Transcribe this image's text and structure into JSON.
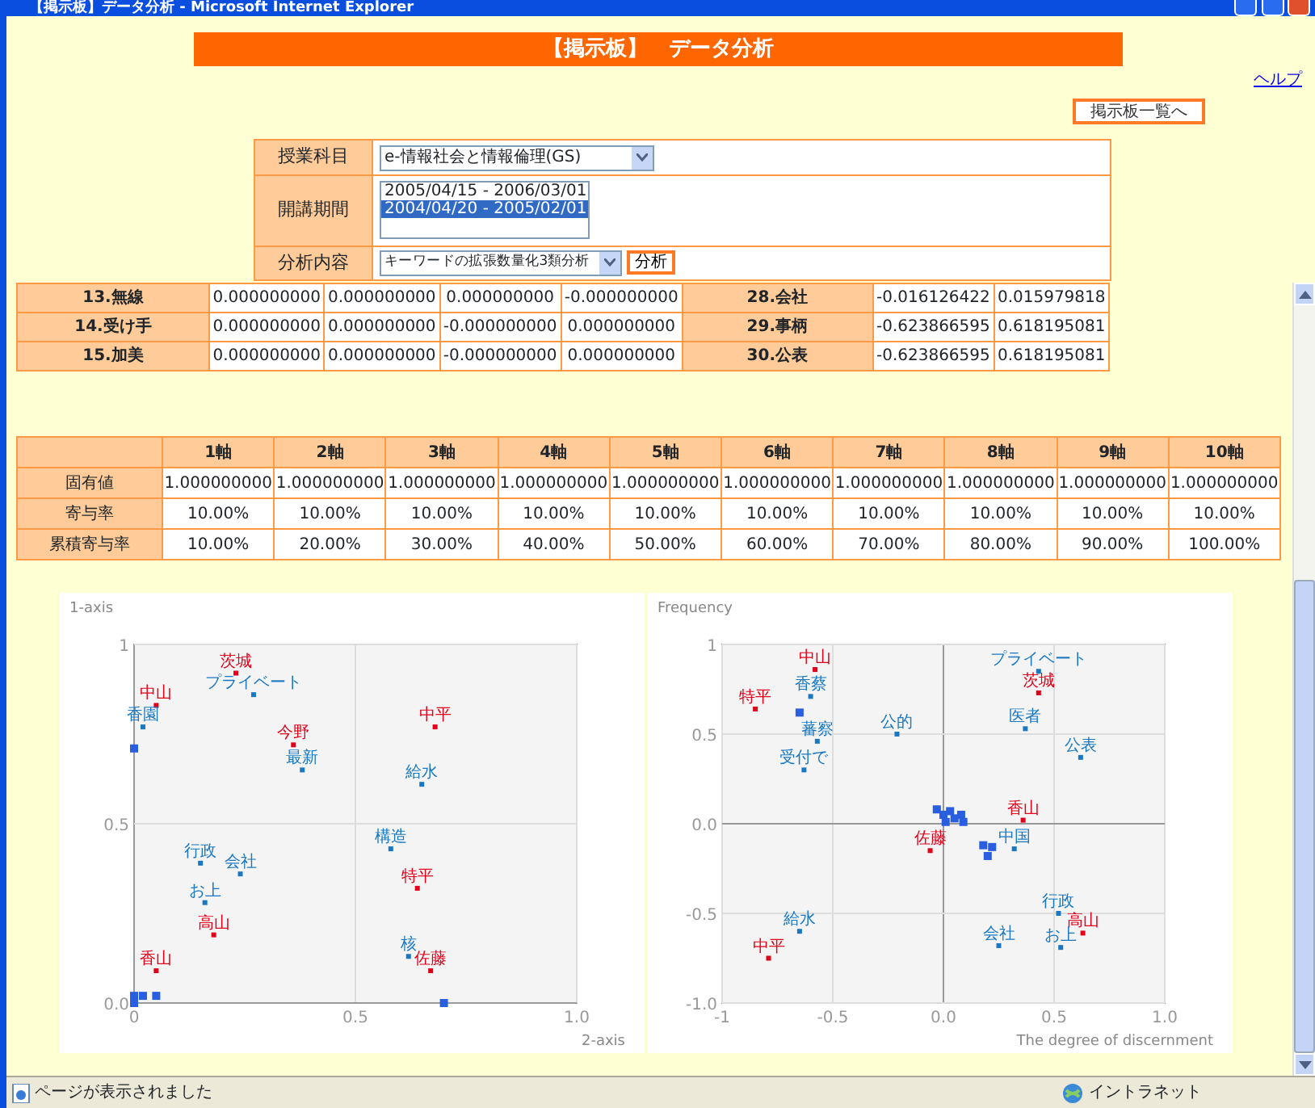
{
  "window": {
    "title": "【掲示板】データ分析 - Microsoft Internet Explorer"
  },
  "banner": {
    "title": "【掲示板】　データ分析"
  },
  "help_link": "ヘルプ",
  "board_list_button": "掲示板一覧へ",
  "form": {
    "rows": [
      {
        "label": "授業科目",
        "kind": "select",
        "value": "e-情報社会と情報倫理(GS)"
      },
      {
        "label": "開講期間",
        "kind": "listbox",
        "options": [
          {
            "text": "2005/04/15 - 2006/03/01",
            "selected": false
          },
          {
            "text": "2004/04/20 - 2005/02/01",
            "selected": true
          }
        ]
      },
      {
        "label": "分析内容",
        "kind": "select_button",
        "value": "キーワードの拡張数量化3類分析",
        "button": "分析"
      }
    ]
  },
  "score_table": {
    "rows": [
      {
        "term1": "13.無線",
        "values1": [
          "0.000000000",
          "0.000000000",
          "0.000000000",
          "-0.000000000"
        ],
        "term2": "28.会社",
        "values2": [
          "-0.016126422",
          "0.015979818"
        ]
      },
      {
        "term1": "14.受け手",
        "values1": [
          "0.000000000",
          "0.000000000",
          "-0.000000000",
          "0.000000000"
        ],
        "term2": "29.事柄",
        "values2": [
          "-0.623866595",
          "0.618195081"
        ]
      },
      {
        "term1": "15.加美",
        "values1": [
          "0.000000000",
          "0.000000000",
          "-0.000000000",
          "0.000000000"
        ],
        "term2": "30.公表",
        "values2": [
          "-0.623866595",
          "0.618195081"
        ]
      }
    ]
  },
  "axis_table": {
    "columns": [
      "1軸",
      "2軸",
      "3軸",
      "4軸",
      "5軸",
      "6軸",
      "7軸",
      "8軸",
      "9軸",
      "10軸"
    ],
    "rows": [
      {
        "label": "固有値",
        "values": [
          "1.000000000",
          "1.000000000",
          "1.000000000",
          "1.000000000",
          "1.000000000",
          "1.000000000",
          "1.000000000",
          "1.000000000",
          "1.000000000",
          "1.000000000"
        ]
      },
      {
        "label": "寄与率",
        "values": [
          "10.00%",
          "10.00%",
          "10.00%",
          "10.00%",
          "10.00%",
          "10.00%",
          "10.00%",
          "10.00%",
          "10.00%",
          "10.00%"
        ]
      },
      {
        "label": "累積寄与率",
        "values": [
          "10.00%",
          "20.00%",
          "30.00%",
          "40.00%",
          "50.00%",
          "60.00%",
          "70.00%",
          "80.00%",
          "90.00%",
          "100.00%"
        ]
      }
    ]
  },
  "charts": [
    {
      "chart_data": {
        "type": "scatter",
        "grid": true,
        "xlabel": "2-axis",
        "ylabel": "1-axis",
        "xlim": [
          0,
          1
        ],
        "ylim": [
          0,
          1
        ],
        "xticks": [
          {
            "value": 0,
            "label": "0"
          },
          {
            "value": 0.5,
            "label": "0.5"
          },
          {
            "value": 1,
            "label": "1.0"
          }
        ],
        "yticks": [
          {
            "value": 0,
            "label": "0.0"
          },
          {
            "value": 0.5,
            "label": "0.5"
          },
          {
            "value": 1,
            "label": "1"
          }
        ],
        "x": [
          0.23,
          0.27,
          0.05,
          0.02,
          0.36,
          0.38,
          0.68,
          0.65,
          0.58,
          0.15,
          0.24,
          0.64,
          0.16,
          0.18,
          0.62,
          0.05,
          0.67,
          0,
          0,
          0,
          0.02,
          0.05,
          0.7
        ],
        "series": [
          {
            "color": "#e0001a",
            "values": [
              0.92,
              null,
              0.83,
              null,
              0.72,
              null,
              0.77,
              null,
              null,
              null,
              null,
              0.32,
              null,
              0.19,
              null,
              0.09,
              0.09,
              null,
              null,
              null,
              null,
              null,
              null
            ]
          },
          {
            "color": "#1a78c2",
            "values": [
              null,
              0.86,
              null,
              0.77,
              null,
              0.65,
              null,
              0.61,
              0.43,
              0.39,
              0.36,
              null,
              0.28,
              null,
              0.13,
              null,
              null,
              null,
              null,
              null,
              null,
              null,
              null
            ]
          },
          {
            "color": "#2a5ee0",
            "values": [
              null,
              null,
              null,
              null,
              null,
              null,
              null,
              null,
              null,
              null,
              null,
              null,
              null,
              null,
              null,
              null,
              null,
              0.71,
              0.02,
              0,
              0.02,
              0.02,
              0
            ]
          }
        ],
        "annotations": [
          "茨城",
          "プライベート",
          "中山",
          "香園",
          "今野",
          "最新",
          "中平",
          "給水",
          "構造",
          "行政",
          "会社",
          "特平",
          "お上",
          "高山",
          "核",
          "香山",
          "佐藤"
        ]
      }
    },
    {
      "chart_data": {
        "type": "scatter",
        "grid": true,
        "xlabel": "The degree of discernment",
        "ylabel": "Frequency",
        "xlim": [
          -1,
          1
        ],
        "ylim": [
          -1,
          1
        ],
        "xticks": [
          {
            "value": -1,
            "label": "-1"
          },
          {
            "value": -0.5,
            "label": "-0.5"
          },
          {
            "value": 0,
            "label": "0.0"
          },
          {
            "value": 0.5,
            "label": "0.5"
          },
          {
            "value": 1,
            "label": "1.0"
          }
        ],
        "yticks": [
          {
            "value": -1,
            "label": "-1.0"
          },
          {
            "value": -0.5,
            "label": "-0.5"
          },
          {
            "value": 0,
            "label": "0.0"
          },
          {
            "value": 0.5,
            "label": "0.5"
          },
          {
            "value": 1,
            "label": "1"
          }
        ],
        "x": [
          0.43,
          -0.58,
          0.43,
          -0.85,
          -0.6,
          0.37,
          -0.21,
          -0.57,
          -0.63,
          0.62,
          -0.06,
          0.36,
          0.32,
          0.52,
          0.63,
          -0.65,
          0.25,
          0.53,
          -0.79,
          -0.65,
          -0.03,
          0,
          0.03,
          0.05,
          0.08,
          0.01,
          0.09,
          0.18,
          0.2,
          0.22
        ],
        "series": [
          {
            "color": "#e0001a",
            "values": [
              null,
              0.86,
              0.73,
              0.64,
              null,
              null,
              null,
              null,
              null,
              null,
              -0.15,
              0.02,
              null,
              null,
              -0.61,
              null,
              null,
              null,
              -0.75,
              null,
              null,
              null,
              null,
              null,
              null,
              null,
              null,
              null,
              null,
              null
            ]
          },
          {
            "color": "#1a78c2",
            "values": [
              0.85,
              null,
              null,
              null,
              0.71,
              0.53,
              0.5,
              0.46,
              0.3,
              0.37,
              null,
              null,
              -0.14,
              -0.5,
              null,
              -0.6,
              -0.68,
              -0.69,
              null,
              null,
              null,
              null,
              null,
              null,
              null,
              null,
              null,
              null,
              null,
              null
            ]
          },
          {
            "color": "#2a5ee0",
            "values": [
              null,
              null,
              null,
              null,
              null,
              null,
              null,
              null,
              null,
              null,
              null,
              null,
              null,
              null,
              null,
              null,
              null,
              null,
              null,
              0.62,
              0.08,
              0.05,
              0.07,
              0.03,
              0.05,
              0.01,
              0.01,
              -0.12,
              -0.18,
              -0.13
            ]
          }
        ],
        "annotations": [
          "プライベート",
          "中山",
          "茨城",
          "特平",
          "香蔡",
          "医者",
          "公的",
          "蕃察",
          "受付で",
          "公表",
          "佐藤",
          "香山",
          "中国",
          "行政",
          "高山",
          "給水",
          "会社",
          "お上",
          "中平"
        ]
      }
    }
  ],
  "status_bar": {
    "message": "ページが表示されました",
    "zone": "イントラネット"
  }
}
